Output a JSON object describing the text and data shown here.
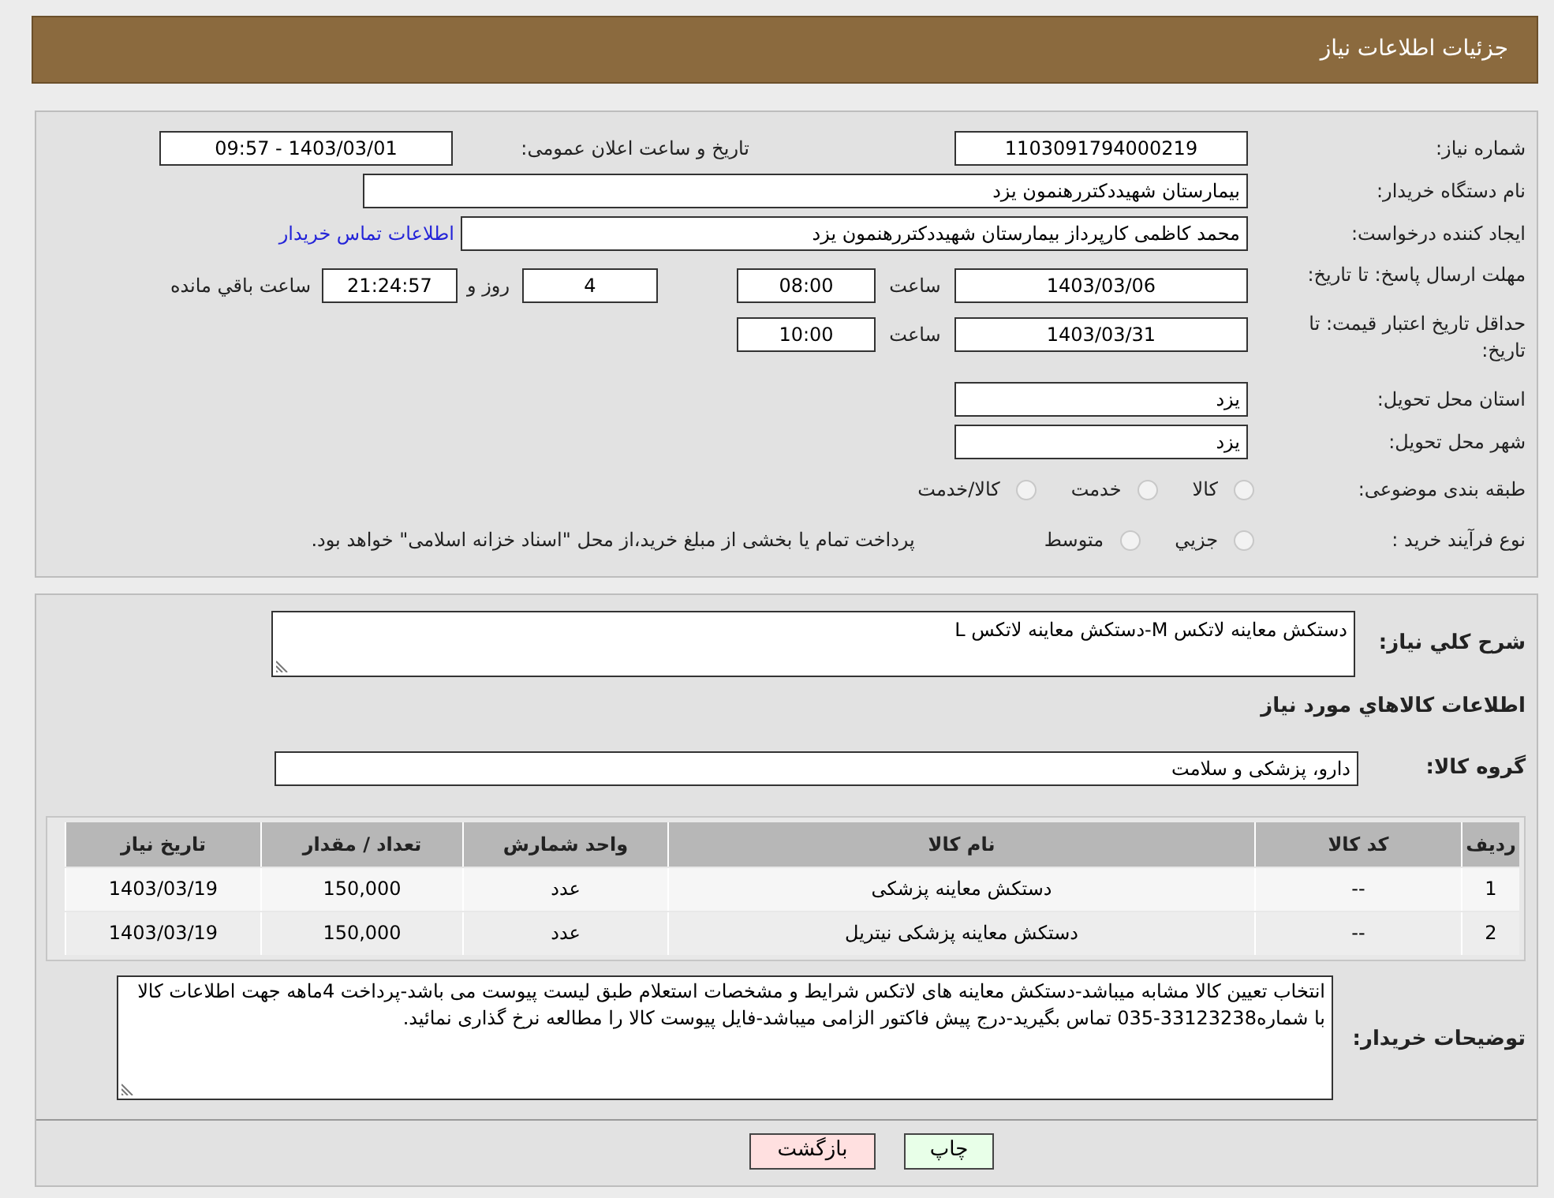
{
  "header": {
    "title": "جزئیات اطلاعات نیاز"
  },
  "need_number": {
    "label": "شماره نیاز:",
    "value": "1103091794000219"
  },
  "announce": {
    "label": "تاریخ و ساعت اعلان عمومی:",
    "value": "1403/03/01 - 09:57"
  },
  "buyer_org": {
    "label": "نام دستگاه خریدار:",
    "value": "بیمارستان شهیددکتررهنمون یزد"
  },
  "requester": {
    "label": "ایجاد کننده درخواست:",
    "value": "محمد کاظمی کارپرداز بیمارستان شهیددکتررهنمون یزد",
    "link": "اطلاعات تماس خریدار"
  },
  "deadline": {
    "label": "مهلت ارسال پاسخ: تا تاریخ:",
    "date": "1403/03/06",
    "time_label": "ساعت",
    "time": "08:00",
    "days": "4",
    "days_label": "روز و",
    "remaining": "21:24:57",
    "remaining_label": "ساعت باقي مانده"
  },
  "price_validity": {
    "label": "حداقل تاریخ اعتبار قیمت: تا تاریخ:",
    "date": "1403/03/31",
    "time_label": "ساعت",
    "time": "10:00"
  },
  "province": {
    "label": "استان محل تحویل:",
    "value": "یزد"
  },
  "city": {
    "label": "شهر محل تحویل:",
    "value": "یزد"
  },
  "category": {
    "label": "طبقه بندی موضوعی:",
    "options": [
      {
        "label": "کالا",
        "selected": false
      },
      {
        "label": "خدمت",
        "selected": false
      },
      {
        "label": "کالا/خدمت",
        "selected": false
      }
    ]
  },
  "process": {
    "label": "نوع فرآیند خرید :",
    "options": [
      {
        "label": "جزيي",
        "selected": false
      },
      {
        "label": "متوسط",
        "selected": false
      }
    ],
    "note": "پرداخت تمام یا بخشی از مبلغ خرید،از محل \"اسناد خزانه اسلامی\" خواهد بود."
  },
  "description": {
    "label": "شرح كلي نياز:",
    "value": "دستکش معاینه لاتکس M-دستکش معاینه لاتکس L"
  },
  "goods_heading": "اطلاعات کالاهاي مورد نياز",
  "goods_group": {
    "label": "گروه کالا:",
    "value": "دارو، پزشکی و سلامت"
  },
  "table": {
    "columns": [
      "ردیف",
      "کد کالا",
      "نام کالا",
      "واحد شمارش",
      "تعداد / مقدار",
      "تاریخ نیاز"
    ],
    "rows": [
      [
        "1",
        "--",
        "دستکش معاینه پزشکی",
        "عدد",
        "150,000",
        "1403/03/19"
      ],
      [
        "2",
        "--",
        "دستکش معاینه پزشکی نیتریل",
        "عدد",
        "150,000",
        "1403/03/19"
      ]
    ]
  },
  "buyer_notes": {
    "label": "توضیحات خریدار:",
    "value": "انتخاب تعیین کالا مشابه میباشد-دستکش معاینه های لاتکس شرایط و مشخصات استعلام طبق لیست پیوست می باشد-پرداخت 4ماهه جهت اطلاعات کالا با شماره33123238-035 تماس بگیرید-درج پیش فاکتور الزامی میباشد-فایل پیوست کالا را مطالعه نرخ گذاری نمائید."
  },
  "buttons": [
    {
      "kind": "print",
      "label": "چاپ"
    },
    {
      "kind": "back",
      "label": "بازگشت"
    }
  ]
}
